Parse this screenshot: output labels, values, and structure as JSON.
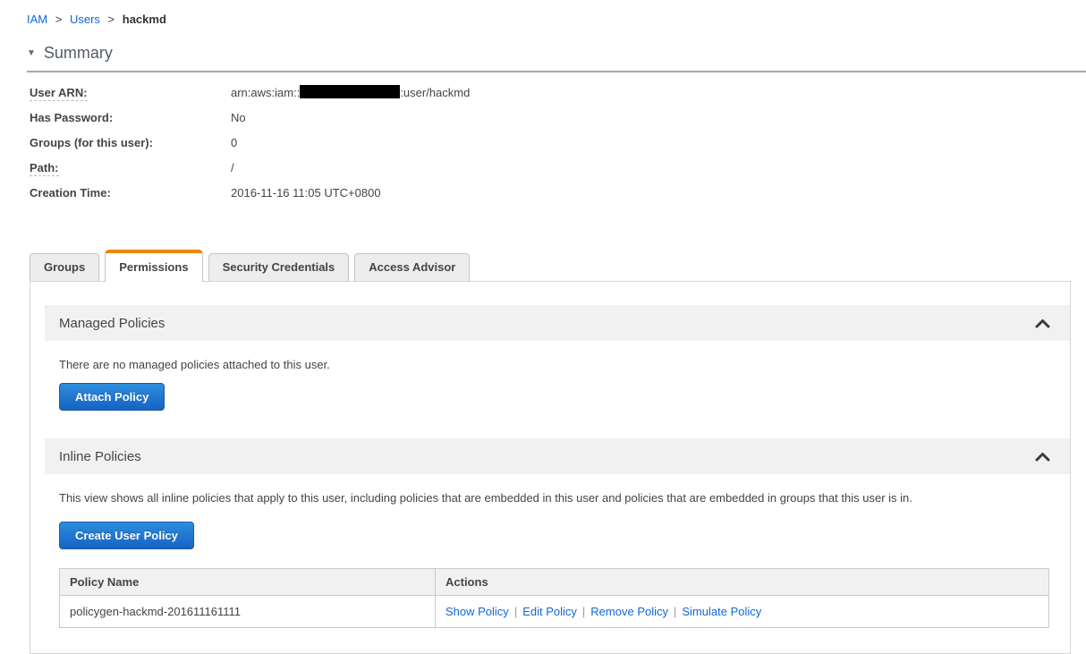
{
  "breadcrumb": {
    "separator": ">",
    "items": [
      {
        "label": "IAM"
      },
      {
        "label": "Users"
      },
      {
        "label": "hackmd"
      }
    ]
  },
  "summary": {
    "title": "Summary",
    "fields": [
      {
        "label": "User ARN:",
        "value_prefix": "arn:aws:iam::",
        "value_suffix": ":user/hackmd",
        "redacted": true
      },
      {
        "label": "Has Password:",
        "value": "No"
      },
      {
        "label": "Groups (for this user):",
        "value": "0"
      },
      {
        "label": "Path:",
        "value": "/"
      },
      {
        "label": "Creation Time:",
        "value": "2016-11-16 11:05 UTC+0800"
      }
    ]
  },
  "tabs": [
    {
      "label": "Groups",
      "active": false
    },
    {
      "label": "Permissions",
      "active": true
    },
    {
      "label": "Security Credentials",
      "active": false
    },
    {
      "label": "Access Advisor",
      "active": false
    }
  ],
  "managed_policies": {
    "title": "Managed Policies",
    "empty_text": "There are no managed policies attached to this user.",
    "attach_button": "Attach Policy"
  },
  "inline_policies": {
    "title": "Inline Policies",
    "description": "This view shows all inline policies that apply to this user, including policies that are embedded in this user and policies that are embedded in groups that this user is in.",
    "create_button": "Create User Policy",
    "table": {
      "headers": [
        "Policy Name",
        "Actions"
      ],
      "action_separator": "|",
      "rows": [
        {
          "policy_name": "policygen-hackmd-201611161111",
          "actions": [
            "Show Policy",
            "Edit Policy",
            "Remove Policy",
            "Simulate Policy"
          ]
        }
      ]
    }
  },
  "colors": {
    "accent_orange": "#e8890c",
    "link_blue": "#1166dd",
    "button_blue_top": "#2d8ede",
    "button_blue_bottom": "#1563c5"
  }
}
